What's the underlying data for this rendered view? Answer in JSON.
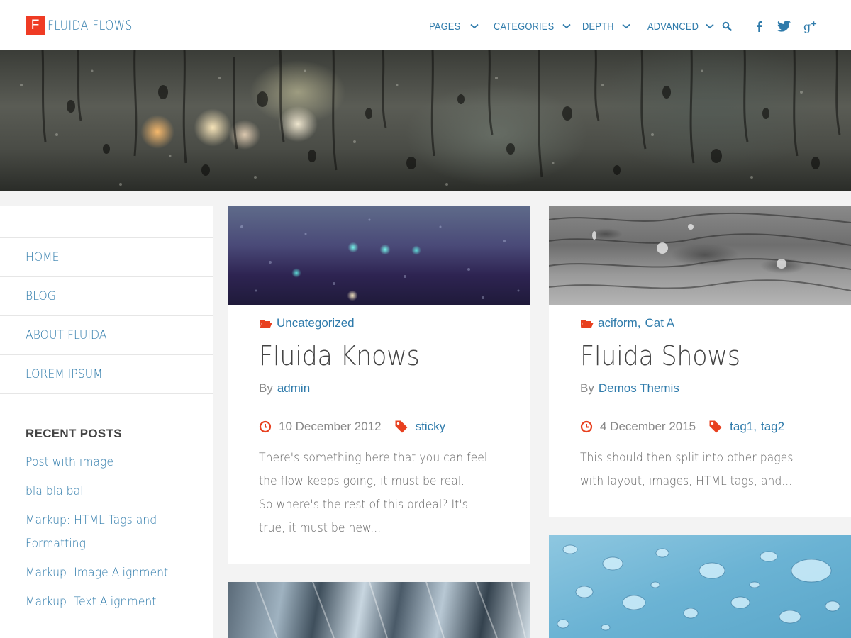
{
  "header": {
    "logo_letter": "F",
    "logo_text": "FLUIDA FLOWS",
    "nav": [
      {
        "label": "PAGES"
      },
      {
        "label": "CATEGORIES"
      },
      {
        "label": "DEPTH"
      },
      {
        "label": "ADVANCED"
      }
    ],
    "icons": [
      "search-icon",
      "facebook-icon",
      "twitter-icon",
      "google-plus-icon"
    ]
  },
  "sidebar": {
    "menu": [
      {
        "label": "HOME"
      },
      {
        "label": "BLOG"
      },
      {
        "label": "ABOUT FLUIDA"
      },
      {
        "label": "LOREM IPSUM"
      }
    ],
    "recent_title": "RECENT POSTS",
    "recent_posts": [
      {
        "label": "Post with image"
      },
      {
        "label": "bla bla bal"
      },
      {
        "label": "Markup: HTML Tags and Formatting"
      },
      {
        "label": "Markup: Image Alignment"
      },
      {
        "label": "Markup: Text Alignment"
      }
    ]
  },
  "posts": [
    {
      "categories": [
        "Uncategorized"
      ],
      "title": "Fluida Knows",
      "by": "By",
      "author": "admin",
      "date": "10 December 2012",
      "tags": [
        "sticky"
      ],
      "excerpt": [
        "There's something here that you can feel,",
        "the flow keeps going, it must be real.",
        "So where's the rest of this ordeal? It's",
        "true, it must be new..."
      ]
    },
    {
      "categories": [
        "aciform",
        "Cat A"
      ],
      "title": "Fluida Shows",
      "by": "By",
      "author": "Demos Themis",
      "date": "4 December 2015",
      "tags": [
        "tag1",
        "tag2"
      ],
      "excerpt": [
        "This should then split into other pages",
        "with layout, images, HTML tags, and..."
      ]
    }
  ],
  "colors": {
    "accent": "#2f7bab",
    "brand_red": "#ef3b24",
    "icon_red": "#e8401f",
    "background": "#f3f3f3"
  }
}
